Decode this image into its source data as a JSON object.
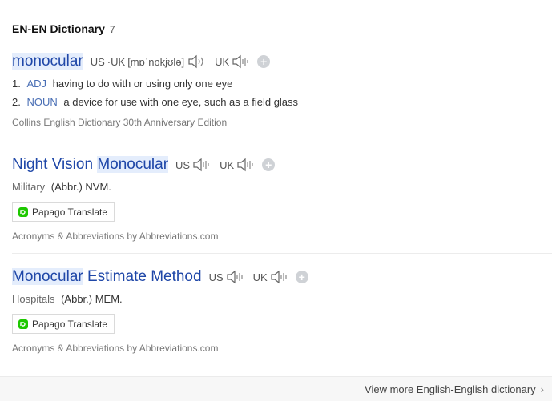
{
  "header": {
    "title": "EN-EN Dictionary",
    "count": "7"
  },
  "entries": [
    {
      "word": "monocular",
      "us_label": "US",
      "sep": "·",
      "uk_label": "UK",
      "ipa": "[mɒˈnɒkjʊlə]",
      "uk_label2": "UK",
      "definitions": [
        {
          "num": "1.",
          "pos": "ADJ",
          "text": "having to do with or using only one eye"
        },
        {
          "num": "2.",
          "pos": "NOUN",
          "text": "a device for use with one eye, such as a field glass"
        }
      ],
      "source": "Collins English Dictionary 30th Anniversary Edition"
    },
    {
      "word_plain": "Night Vision ",
      "word_hl": "Monocular",
      "us_label": "US",
      "uk_label": "UK",
      "field": "Military",
      "text": "(Abbr.) NVM.",
      "translate_button": "Papago Translate",
      "source": "Acronyms & Abbreviations by Abbreviations.com"
    },
    {
      "word_hl": "Monocular",
      "word_plain": " Estimate Method",
      "us_label": "US",
      "uk_label": "UK",
      "field": "Hospitals",
      "text": "(Abbr.) MEM.",
      "translate_button": "Papago Translate",
      "source": "Acronyms & Abbreviations by Abbreviations.com"
    }
  ],
  "footer": {
    "more_link": "View more English-English dictionary",
    "chevron": "›"
  },
  "colors": {
    "headword": "#1f47a8",
    "highlight": "#e4edfc",
    "pos": "#4a6fb5",
    "papago_green": "#1ec800"
  },
  "icons": {
    "speaker": "speaker-icon",
    "add": "plus-icon",
    "papago": "papago-logo-icon",
    "chevron": "chevron-right-icon"
  }
}
